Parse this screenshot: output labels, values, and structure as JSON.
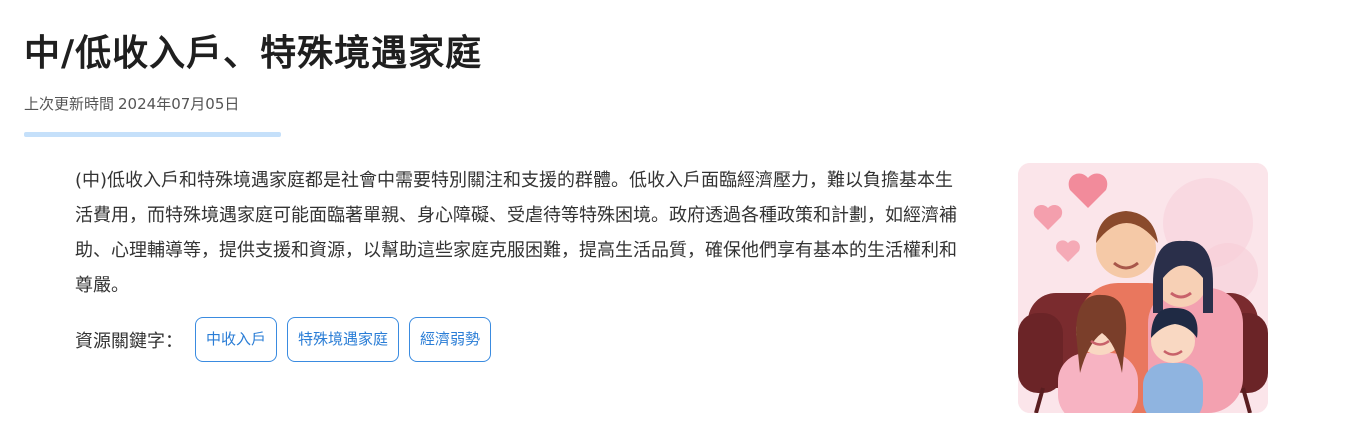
{
  "header": {
    "title": "中/低收入戶、特殊境遇家庭",
    "updated_label": "上次更新時間",
    "updated_date": "2024年07月05日"
  },
  "content": {
    "description": "(中)低收入戶和特殊境遇家庭都是社會中需要特別關注和支援的群體。低收入戶面臨經濟壓力，難以負擔基本生活費用，而特殊境遇家庭可能面臨著單親、身心障礙、受虐待等特殊困境。政府透過各種政策和計劃，如經濟補助、心理輔導等，提供支援和資源，以幫助這些家庭克服困難，提高生活品質，確保他們享有基本的生活權利和尊嚴。"
  },
  "keywords": {
    "label": "資源關鍵字：",
    "tags": [
      "中收入戶",
      "特殊境遇家庭",
      "經濟弱勢"
    ]
  },
  "illustration": {
    "icon": "family-illustration",
    "colors": {
      "background": "#fbe5ea",
      "sofa": "#7a2b2e",
      "heart": "#f28b9b",
      "shirt_father": "#e9775e",
      "shirt_mother": "#f3a1b0",
      "shirt_girl": "#f7b3c2",
      "shirt_boy": "#8fb4e0"
    }
  }
}
